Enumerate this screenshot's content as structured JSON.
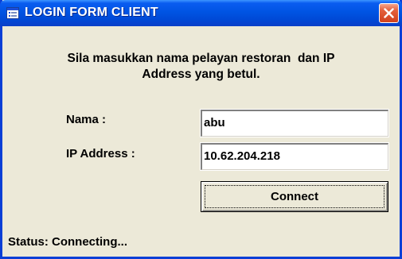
{
  "window": {
    "title": "LOGIN FORM CLIENT",
    "icon": "application-icon",
    "close_icon": "close-icon",
    "colors": {
      "titlebar": "#0054e3",
      "close_button": "#d1411c",
      "body": "#ece9d8"
    }
  },
  "form": {
    "instruction_line1": "Sila masukkan nama pelayan restoran  dan IP",
    "instruction_line2": "Address yang betul.",
    "name_label": "Nama :",
    "name_value": "abu",
    "ip_label": "IP Address :",
    "ip_value": "10.62.204.218",
    "connect_label": "Connect"
  },
  "status": {
    "text": "Status: Connecting..."
  }
}
